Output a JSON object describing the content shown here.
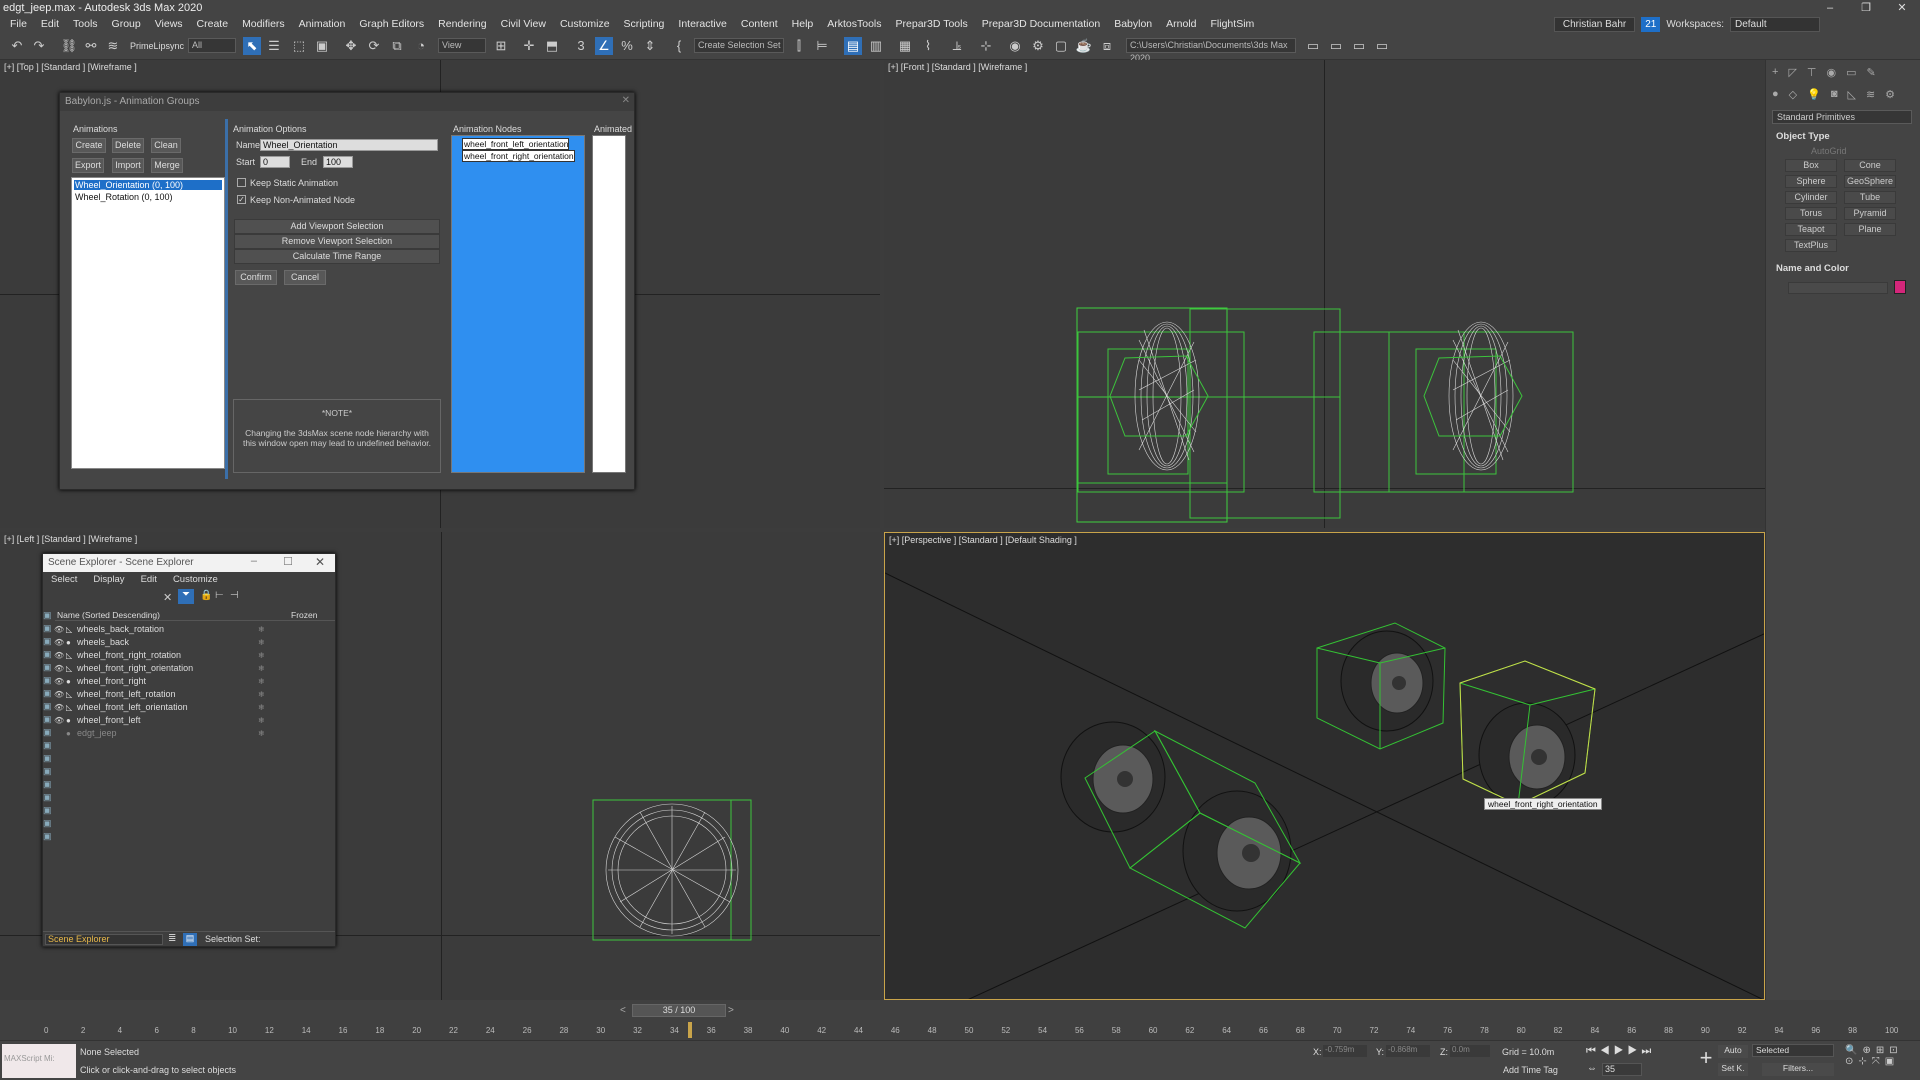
{
  "window": {
    "title": "edgt_jeep.max - Autodesk 3ds Max 2020",
    "min": "–",
    "max": "❐",
    "close": "✕"
  },
  "menu": [
    "File",
    "Edit",
    "Tools",
    "Group",
    "Views",
    "Create",
    "Modifiers",
    "Animation",
    "Graph Editors",
    "Rendering",
    "Civil View",
    "Customize",
    "Scripting",
    "Interactive",
    "Content",
    "Help",
    "ArktosTools",
    "Prepar3D Tools",
    "Prepar3D Documentation",
    "Babylon",
    "Arnold",
    "FlightSim"
  ],
  "user": {
    "name": "Christian Bahr",
    "count": "21",
    "workspaces_label": "Workspaces:",
    "workspace": "Default"
  },
  "toolbar": {
    "prime": "PrimeLipsync",
    "filter": "All",
    "view": "View",
    "selset": "Create Selection Set",
    "path": "C:\\Users\\Christian\\Documents\\3ds Max 2020"
  },
  "viewports": {
    "top": "[+] [Top ] [Standard ] [Wireframe ]",
    "front": "[+] [Front ] [Standard ] [Wireframe ]",
    "left": "[+] [Left ] [Standard ] [Wireframe ]",
    "persp": "[+] [Perspective ] [Standard ] [Default Shading ]",
    "tooltip": "wheel_front_right_orientation"
  },
  "anim_dialog": {
    "title": "Babylon.js - Animation Groups",
    "animations_label": "Animations",
    "buttons": {
      "create": "Create",
      "delete": "Delete",
      "clean": "Clean",
      "export": "Export",
      "import": "Import",
      "merge": "Merge"
    },
    "groups": [
      "Wheel_Orientation (0, 100)",
      "Wheel_Rotation (0, 100)"
    ],
    "options_label": "Animation Options",
    "name_label": "Name",
    "name_value": "Wheel_Orientation",
    "start_label": "Start",
    "start_value": "0",
    "end_label": "End",
    "end_value": "100",
    "keep_static": "Keep Static Animation",
    "keep_non_animated": "Keep Non-Animated Node",
    "add_sel": "Add Viewport Selection",
    "remove_sel": "Remove Viewport Selection",
    "calc_range": "Calculate Time Range",
    "confirm": "Confirm",
    "cancel": "Cancel",
    "note_title": "*NOTE*",
    "note_text": "Changing the 3dsMax scene node hierarchy with this window open may lead to undefined behavior.",
    "nodes_label": "Animation Nodes",
    "nodes": [
      "wheel_front_left_orientation",
      "wheel_front_right_orientation"
    ],
    "animated_label": "Animated"
  },
  "scene_explorer": {
    "title": "Scene Explorer - Scene Explorer",
    "menu": [
      "Select",
      "Display",
      "Edit",
      "Customize"
    ],
    "col_name": "Name (Sorted Descending)",
    "col_frozen": "Frozen",
    "rows": [
      "wheels_back_rotation",
      "wheels_back",
      "wheel_front_right_rotation",
      "wheel_front_right_orientation",
      "wheel_front_right",
      "wheel_front_left_rotation",
      "wheel_front_left_orientation",
      "wheel_front_left",
      "edgt_jeep"
    ],
    "footer_combo": "Scene Explorer",
    "footer_label": "Selection Set:"
  },
  "command_panel": {
    "primitives": "Standard Primitives",
    "object_type": "Object Type",
    "autogrid": "AutoGrid",
    "buttons": [
      "Box",
      "Cone",
      "Sphere",
      "GeoSphere",
      "Cylinder",
      "Tube",
      "Torus",
      "Pyramid",
      "Teapot",
      "Plane",
      "TextPlus"
    ],
    "name_color": "Name and Color",
    "swatch": "#d4267a"
  },
  "timeline": {
    "frame": "35 / 100",
    "ticks": [
      "0",
      "2",
      "4",
      "6",
      "8",
      "10",
      "12",
      "14",
      "16",
      "18",
      "20",
      "22",
      "24",
      "26",
      "28",
      "30",
      "32",
      "34",
      "36",
      "38",
      "40",
      "42",
      "44",
      "46",
      "48",
      "50",
      "52",
      "54",
      "56",
      "58",
      "60",
      "62",
      "64",
      "66",
      "68",
      "70",
      "72",
      "74",
      "76",
      "78",
      "80",
      "82",
      "84",
      "86",
      "88",
      "90",
      "92",
      "94",
      "96",
      "98",
      "100"
    ],
    "current": 35
  },
  "status": {
    "maxscript": "MAXScript Mi:",
    "none_selected": "None Selected",
    "hint": "Click or click-and-drag to select objects",
    "x": "X:",
    "xv": "-0.759m",
    "y": "Y:",
    "yv": "-0.868m",
    "z": "Z:",
    "zv": "0.0m",
    "grid": "Grid = 10.0m",
    "add_time_tag": "Add Time Tag",
    "auto": "Auto",
    "selected": "Selected",
    "setk": "Set K.",
    "filters": "Filters...",
    "frame_field": "35"
  }
}
